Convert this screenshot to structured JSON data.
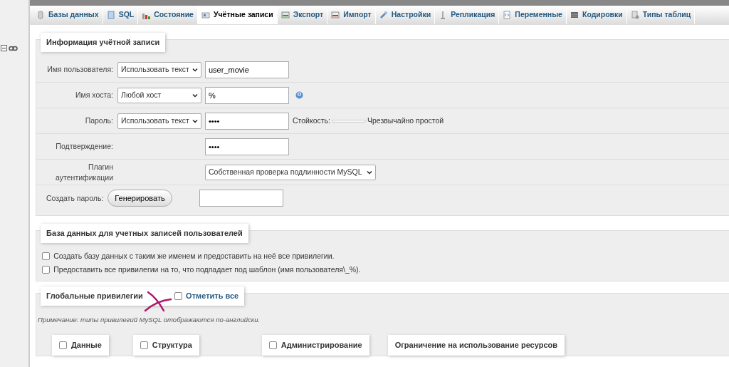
{
  "tabs": [
    {
      "label": "Базы данных",
      "selected": false
    },
    {
      "label": "SQL",
      "selected": false
    },
    {
      "label": "Состояние",
      "selected": false
    },
    {
      "label": "Учётные записи",
      "selected": true
    },
    {
      "label": "Экспорт",
      "selected": false
    },
    {
      "label": "Импорт",
      "selected": false
    },
    {
      "label": "Настройки",
      "selected": false
    },
    {
      "label": "Репликация",
      "selected": false
    },
    {
      "label": "Переменные",
      "selected": false
    },
    {
      "label": "Кодировки",
      "selected": false
    },
    {
      "label": "Типы таблиц",
      "selected": false
    }
  ],
  "account": {
    "legend": "Информация учётной записи",
    "rows": [
      {
        "kind": "select_input",
        "label": "Имя пользователя:",
        "select": "Использовать текст",
        "value": "user_movie"
      },
      {
        "kind": "select_input_help",
        "label": "Имя хоста:",
        "select": "Любой хост",
        "value": "%"
      },
      {
        "kind": "password_strength",
        "label": "Пароль:",
        "select": "Использовать текст",
        "value": "••••",
        "strength_label": "Стойкость:",
        "level": 0,
        "strength_text": "Чрезвычайно простой"
      },
      {
        "kind": "input",
        "label": "Подтверждение:",
        "value": "••••"
      },
      {
        "kind": "plugin",
        "label": "Плагин аутентификации",
        "select": "Собственная проверка подлинности MySQL"
      },
      {
        "kind": "generate",
        "label": "Создать пароль:",
        "button": "Генерировать"
      }
    ]
  },
  "database": {
    "legend": "База данных для учетных записей пользователей",
    "options": [
      {
        "label": "Создать базу данных с таким же именем и предоставить на неё все привилегии.",
        "checked": false
      },
      {
        "label": "Предоставить все привилегии на то, что подпадает под шаблон (имя пользователя\\_%).",
        "checked": false
      }
    ]
  },
  "global": {
    "legend": "Глобальные привилегии",
    "check_all": {
      "label": "Отметить все",
      "checked": false
    },
    "note": "Примечание: типы привилегий MySQL отображаются по-английски.",
    "groups": [
      {
        "label": "Данные",
        "checked": false,
        "kind": "checkbox"
      },
      {
        "label": "Структура",
        "checked": false,
        "kind": "checkbox"
      },
      {
        "label": "Администрирование",
        "checked": false,
        "kind": "checkbox"
      },
      {
        "label": "Ограничение на использование ресурсов",
        "kind": "plain"
      }
    ]
  }
}
